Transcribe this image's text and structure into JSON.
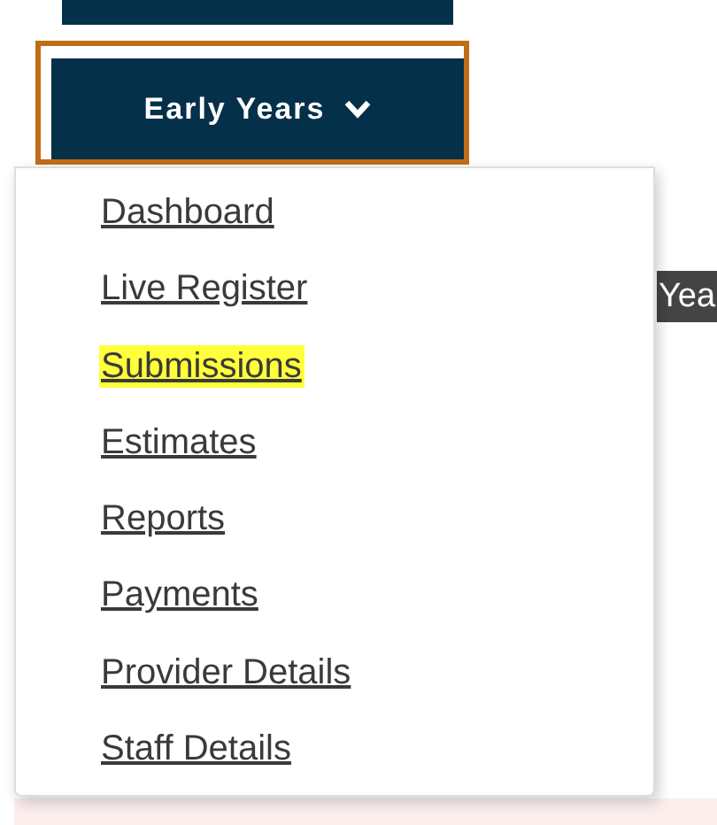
{
  "menu_button": {
    "label": "Early Years",
    "expanded": true,
    "focused": true
  },
  "background_tab": {
    "label": "Yea"
  },
  "menu_items": [
    {
      "label": "Dashboard",
      "highlighted": false
    },
    {
      "label": "Live Register",
      "highlighted": false
    },
    {
      "label": "Submissions",
      "highlighted": true
    },
    {
      "label": "Estimates",
      "highlighted": false
    },
    {
      "label": "Reports",
      "highlighted": false
    },
    {
      "label": "Payments",
      "highlighted": false
    },
    {
      "label": "Provider Details",
      "highlighted": false
    },
    {
      "label": "Staff Details",
      "highlighted": false
    }
  ]
}
